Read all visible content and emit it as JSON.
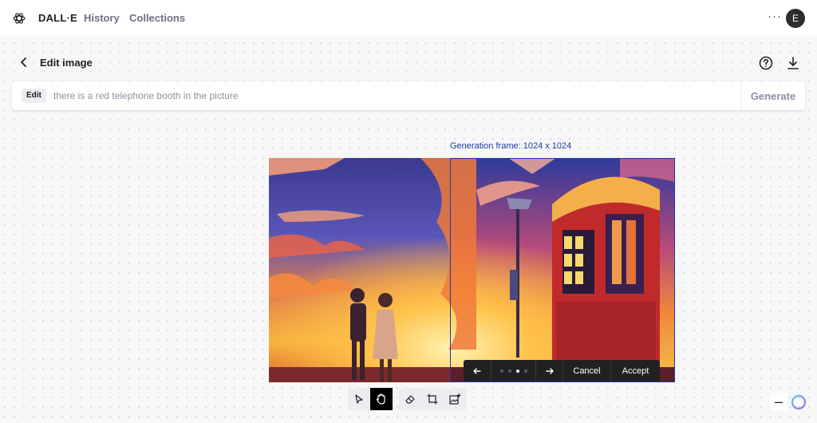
{
  "header": {
    "logo_icon": "openai-logo-icon",
    "brand": "DALL·E",
    "nav": [
      "History",
      "Collections"
    ],
    "more_label": "···",
    "avatar_initial": "E"
  },
  "subheader": {
    "title": "Edit image",
    "back_icon": "chevron-left-icon",
    "help_icon": "question-circle-icon",
    "download_icon": "download-icon"
  },
  "prompt": {
    "mode_badge": "Edit",
    "value": "there is a red telephone booth in the picture",
    "generate_label": "Generate"
  },
  "canvas": {
    "frame_label": "Generation frame: 1024 x 1024"
  },
  "variants": {
    "prev_icon": "arrow-left-icon",
    "next_icon": "arrow-right-icon",
    "count": 4,
    "active_index": 2,
    "cancel_label": "Cancel",
    "accept_label": "Accept"
  },
  "toolbar": {
    "tools": [
      "select-icon",
      "hand-icon",
      "eraser-icon",
      "crop-frame-icon",
      "add-image-icon"
    ],
    "active_tool": "hand-icon"
  },
  "zoom": {
    "out_label": "–"
  },
  "colors": {
    "accent": "#1c3aa9",
    "dark": "#202123"
  }
}
